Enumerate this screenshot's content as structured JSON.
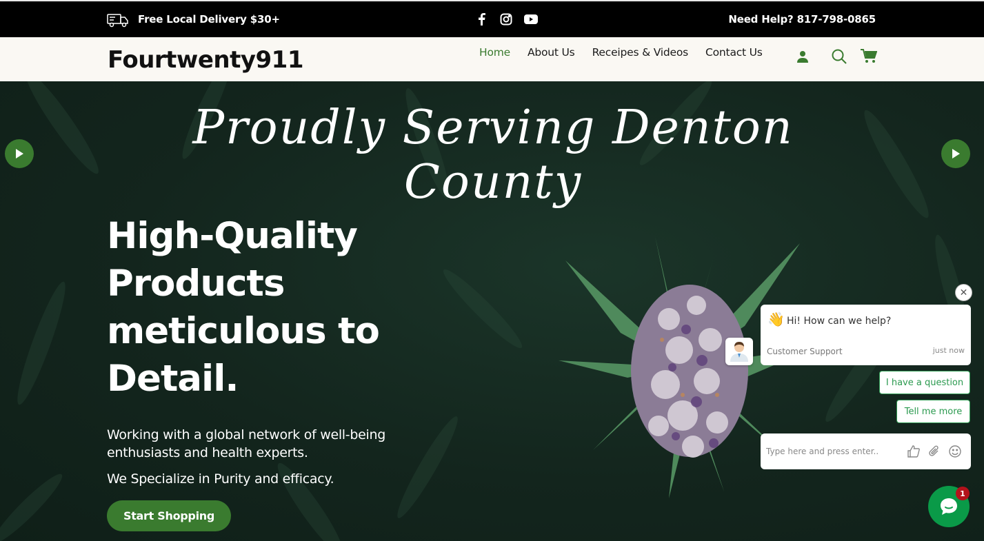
{
  "topbar": {
    "promo": "Free Local Delivery $30+",
    "social": [
      "facebook-icon",
      "instagram-icon",
      "youtube-icon"
    ],
    "help": "Need Help? 817-798-0865"
  },
  "nav": {
    "logo": "Fourtwenty911",
    "items": [
      {
        "label": "Home",
        "active": true
      },
      {
        "label": "About Us",
        "active": false
      },
      {
        "label": "Receipes & Videos",
        "active": false
      },
      {
        "label": "Contact Us",
        "active": false
      }
    ],
    "icons": [
      "user-icon",
      "search-icon",
      "cart-icon"
    ]
  },
  "hero": {
    "script_title": "Proudly Serving Denton County",
    "headline": "High-Quality Products meticulous to Detail.",
    "desc1": "Working with a global network of well-being enthusiasts and health experts.",
    "desc2": "We Specialize in Purity and efficacy.",
    "cta": "Start Shopping"
  },
  "chat": {
    "close": "✕",
    "wave": "👋",
    "greeting": "Hi! How can we help?",
    "agent": "Customer Support",
    "time": "just now",
    "quick_replies": [
      "I have a question",
      "Tell me more"
    ],
    "input_placeholder": "Type here and press enter..",
    "badge_count": "1"
  },
  "colors": {
    "accent": "#3a7b2f",
    "chat_green": "#0a9a48",
    "hero_bg": "#14261f",
    "badge": "#b3121b"
  }
}
